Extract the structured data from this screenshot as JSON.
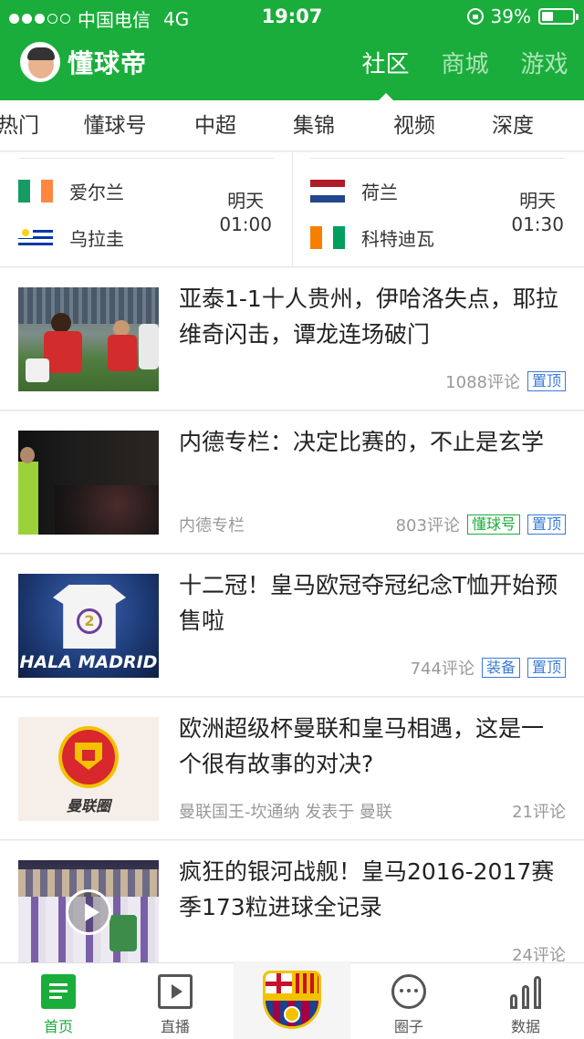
{
  "status_bar": {
    "carrier": "中国电信",
    "network": "4G",
    "time": "19:07",
    "battery": "39%",
    "battery_level": 0.39
  },
  "header": {
    "app_name": "懂球帝",
    "tabs": [
      {
        "label": "社区",
        "active": true
      },
      {
        "label": "商城",
        "active": false
      },
      {
        "label": "游戏",
        "active": false
      }
    ]
  },
  "categories": [
    "热门",
    "懂球号",
    "中超",
    "集锦",
    "视频",
    "深度"
  ],
  "matches": [
    {
      "home": {
        "name": "爱尔兰",
        "flag": [
          "#169b62",
          "#ffffff",
          "#ff883e"
        ]
      },
      "away": {
        "name": "乌拉圭",
        "flag": "uruguay"
      },
      "day": "明天",
      "time": "01:00"
    },
    {
      "home": {
        "name": "荷兰",
        "flag": [
          "#ae1c28",
          "#ffffff",
          "#21468b"
        ]
      },
      "away": {
        "name": "科特迪瓦",
        "flag": [
          "#f77f00",
          "#ffffff",
          "#009e60"
        ]
      },
      "day": "明天",
      "time": "01:30"
    }
  ],
  "news": [
    {
      "title": "亚泰1-1十人贵州，伊哈洛失点，耶拉维奇闪击，谭龙连场破门",
      "source": "",
      "comments": "1088评论",
      "tags": [
        {
          "text": "置顶",
          "color": "blue"
        }
      ]
    },
    {
      "title": "内德专栏：决定比赛的，不止是玄学",
      "source": "内德专栏",
      "comments": "803评论",
      "tags": [
        {
          "text": "懂球号",
          "color": "green"
        },
        {
          "text": "置顶",
          "color": "blue"
        }
      ]
    },
    {
      "title": "十二冠！皇马欧冠夺冠纪念T恤开始预售啦",
      "source": "",
      "comments": "744评论",
      "tags": [
        {
          "text": "装备",
          "color": "blue"
        },
        {
          "text": "置顶",
          "color": "blue"
        }
      ],
      "thumb_text": "HALA MADRID"
    },
    {
      "title": "欧洲超级杯曼联和皇马相遇，这是一个很有故事的对决?",
      "source": "曼联国王-坎通纳 发表于 曼联",
      "comments": "21评论",
      "tags": [],
      "thumb_text": "曼联圈"
    },
    {
      "title": "疯狂的银河战舰！皇马2016-2017赛季173粒进球全记录",
      "source": "",
      "comments": "24评论",
      "tags": []
    }
  ],
  "tabbar": [
    {
      "label": "首页",
      "icon": "list-icon",
      "active": true
    },
    {
      "label": "直播",
      "icon": "play-icon",
      "active": false
    },
    {
      "label": "",
      "icon": "fcb-crest-icon",
      "active": false
    },
    {
      "label": "圈子",
      "icon": "chat-bubble-icon",
      "active": false
    },
    {
      "label": "数据",
      "icon": "bar-chart-icon",
      "active": false
    }
  ],
  "colors": {
    "brand_green": "#1aad3b",
    "tag_blue": "#3a7bd5"
  }
}
